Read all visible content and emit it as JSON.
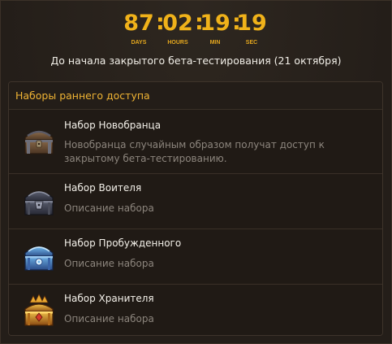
{
  "countdown": {
    "days": "87",
    "hours": "02",
    "minutes": "19",
    "seconds": "19",
    "separator": ":",
    "labels": {
      "days": "DAYS",
      "hours": "HOURS",
      "minutes": "MIN",
      "seconds": "SEC"
    },
    "caption": "До начала закрытого бета-тестирования (21 октября)"
  },
  "panel": {
    "title": "Наборы раннего доступа",
    "packs": [
      {
        "title": "Набор Новобранца",
        "description": "Новобранца случайным образом получат доступ к закрытому бета-тестированию.",
        "icon": "wooden-chest-icon"
      },
      {
        "title": "Набор Воителя",
        "description": "Описание набора",
        "icon": "iron-chest-icon"
      },
      {
        "title": "Набор Пробужденного",
        "description": "Описание набора",
        "icon": "crystal-chest-icon"
      },
      {
        "title": "Набор Хранителя",
        "description": "Описание набора",
        "icon": "golden-chest-icon"
      }
    ]
  },
  "colors": {
    "accent_gold": "#f0b21a",
    "header_gold": "#f0b434",
    "text_light": "#f4f1ea",
    "text_muted": "#8c857d",
    "background": "#2a231d"
  }
}
